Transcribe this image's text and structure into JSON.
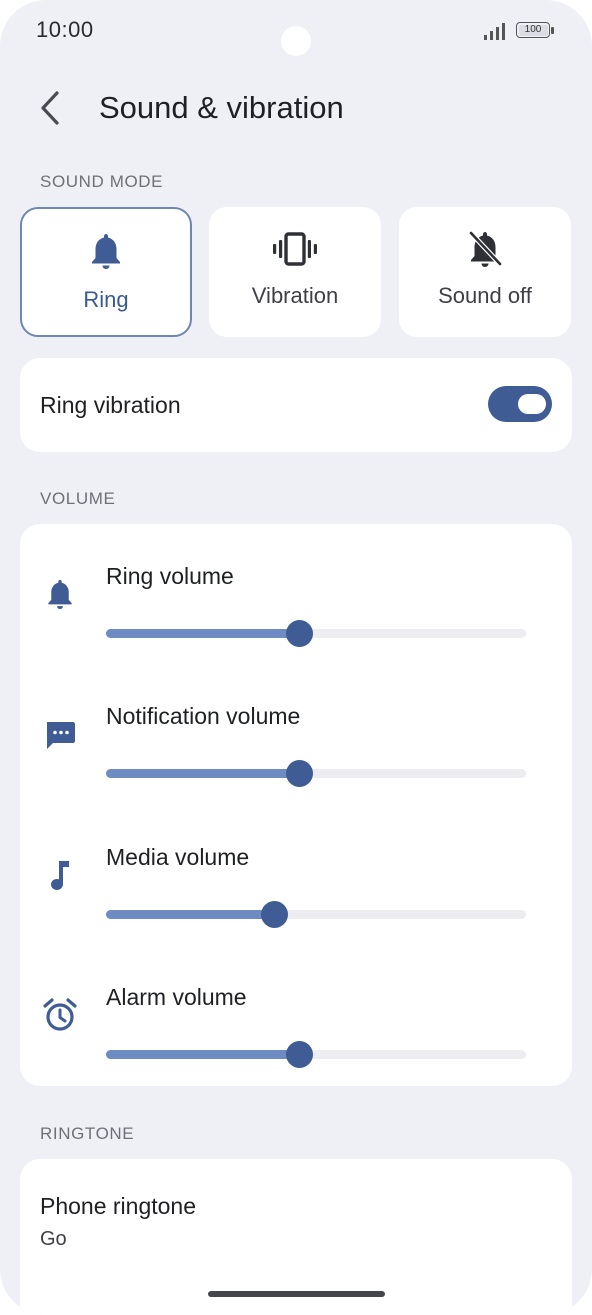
{
  "status_bar": {
    "time": "10:00",
    "battery": "100"
  },
  "header": {
    "title": "Sound & vibration"
  },
  "sound_mode": {
    "section_label": "SOUND MODE",
    "options": [
      {
        "label": "Ring",
        "icon": "bell-icon",
        "selected": true
      },
      {
        "label": "Vibration",
        "icon": "vibration-icon",
        "selected": false
      },
      {
        "label": "Sound off",
        "icon": "bell-off-icon",
        "selected": false
      }
    ]
  },
  "ring_vibration": {
    "label": "Ring vibration",
    "enabled": true
  },
  "volume": {
    "section_label": "VOLUME",
    "sliders": [
      {
        "label": "Ring volume",
        "icon": "bell-icon",
        "value": 0.46
      },
      {
        "label": "Notification volume",
        "icon": "message-icon",
        "value": 0.46
      },
      {
        "label": "Media volume",
        "icon": "music-note-icon",
        "value": 0.4
      },
      {
        "label": "Alarm volume",
        "icon": "alarm-clock-icon",
        "value": 0.46
      }
    ]
  },
  "ringtone": {
    "section_label": "RINGTONE",
    "phone_ringtone": {
      "label": "Phone ringtone",
      "value": "Go"
    }
  },
  "colors": {
    "accent": "#405c95",
    "slider_fill": "#6e8bc4",
    "background": "#eff0f6"
  }
}
